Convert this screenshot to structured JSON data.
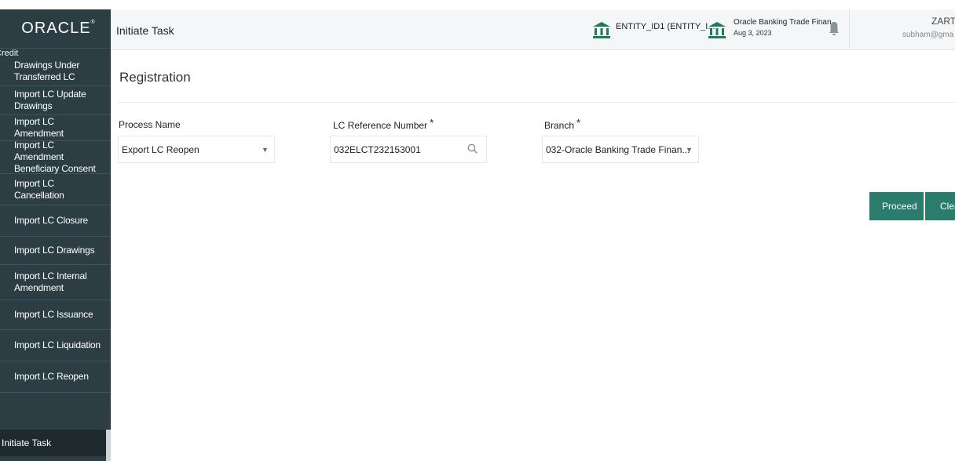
{
  "brand": {
    "logo": "ORACLE",
    "trademark": "®"
  },
  "sidebar": {
    "group_label": "Credit",
    "items": [
      {
        "label": "Drawings Under Transferred LC"
      },
      {
        "label": "Import LC Update Drawings"
      },
      {
        "label": "Import LC Amendment"
      },
      {
        "label": "Import LC Amendment Beneficiary Consent"
      },
      {
        "label": "Import LC Cancellation"
      },
      {
        "label": "Import LC Closure"
      },
      {
        "label": "Import LC Drawings"
      },
      {
        "label": "Import LC Internal Amendment"
      },
      {
        "label": "Import LC Issuance"
      },
      {
        "label": "Import LC Liquidation"
      },
      {
        "label": "Import LC Reopen"
      }
    ],
    "active_item": "Initiate Task"
  },
  "header": {
    "title": "Initiate Task",
    "entity": "ENTITY_ID1 (ENTITY_I...",
    "bank_name": "Oracle Banking Trade Finan...",
    "date": "Aug 3, 2023",
    "user_name": "ZART",
    "user_email": "subham@gma"
  },
  "form": {
    "title": "Registration",
    "process_name": {
      "label": "Process Name",
      "value": "Export LC Reopen"
    },
    "lc_reference": {
      "label": "LC Reference Number",
      "required": "*",
      "value": "032ELCT232153001"
    },
    "branch": {
      "label": "Branch",
      "required": "*",
      "value": "032-Oracle Banking Trade Finan..."
    }
  },
  "actions": {
    "proceed_label": "Proceed",
    "clear_label": "Clea"
  },
  "colors": {
    "sidebar_bg": "#2c3e44",
    "accent": "#2a7d6d",
    "icon": "#1f7a5a"
  },
  "icons": {
    "bank": "bank-icon",
    "bell": "bell-icon",
    "search": "search-icon",
    "dropdown": "chevron-down-icon"
  }
}
